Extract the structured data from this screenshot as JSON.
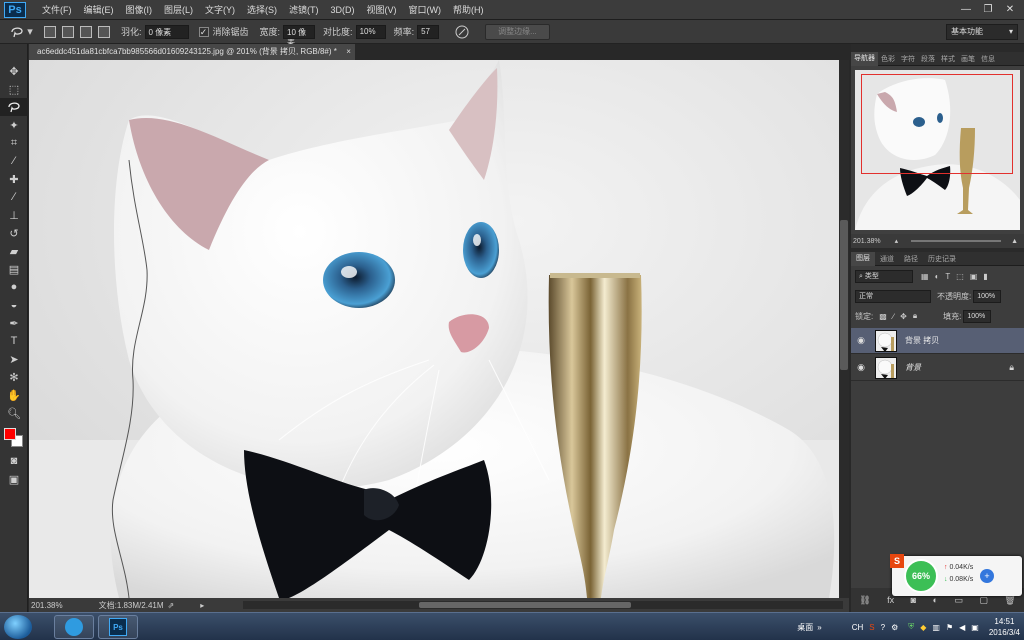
{
  "app": {
    "logo": "Ps"
  },
  "menu": [
    "文件(F)",
    "编辑(E)",
    "图像(I)",
    "图层(L)",
    "文字(Y)",
    "选择(S)",
    "滤镜(T)",
    "3D(D)",
    "视图(V)",
    "窗口(W)",
    "帮助(H)"
  ],
  "window_controls": {
    "minimize": "—",
    "restore": "❐",
    "close": "✕"
  },
  "options": {
    "feather_label": "羽化:",
    "feather_value": "0 像素",
    "antialias_label": "消除锯齿",
    "antialias_checked": "✓",
    "width_label": "宽度:",
    "width_value": "10 像素",
    "contrast_label": "对比度:",
    "contrast_value": "10%",
    "frequency_label": "频率:",
    "frequency_value": "57",
    "refine_edge_label": "调整边缘...",
    "workspace": "基本功能"
  },
  "document": {
    "tab_title": "ac6eddc451da81cbfca7bb985566d01609243125.jpg @ 201% (背景 拷贝, RGB/8#) *",
    "close": "×"
  },
  "status": {
    "zoom": "201.38%",
    "doc_size": "文档:1.83M/2.41M"
  },
  "colors": {
    "foreground": "#ff0000",
    "background": "#ffffff"
  },
  "tools": [
    "move-icon",
    "marquee-icon",
    "lasso-icon",
    "magic-wand-icon",
    "crop-icon",
    "eyedropper-icon",
    "healing-icon",
    "brush-icon",
    "stamp-icon",
    "history-brush-icon",
    "eraser-icon",
    "gradient-icon",
    "blur-icon",
    "dodge-icon",
    "pen-icon",
    "type-icon",
    "path-select-icon",
    "shape-icon",
    "hand-icon",
    "zoom-icon"
  ],
  "navigator": {
    "tabs": [
      "导航器",
      "色彩",
      "字符",
      "段落",
      "样式",
      "画笔",
      "信息"
    ],
    "zoom": "201.38%"
  },
  "layers_panel": {
    "tabs": [
      "图层",
      "通道",
      "路径",
      "历史记录"
    ],
    "kind_filter": "类型",
    "blend_mode": "正常",
    "opacity_label": "不透明度:",
    "opacity_value": "100%",
    "lock_label": "锁定:",
    "fill_label": "填充:",
    "fill_value": "100%",
    "layers": [
      {
        "name": "背景 拷贝",
        "selected": true
      },
      {
        "name": "背景",
        "selected": false,
        "locked": true
      }
    ]
  },
  "network_widget": {
    "percent": "66%",
    "upload": "0.04K/s",
    "download": "0.08K/s"
  },
  "taskbar": {
    "desktop_label": "桌面",
    "ime": "CH",
    "time": "14:51",
    "date": "2016/3/4"
  }
}
